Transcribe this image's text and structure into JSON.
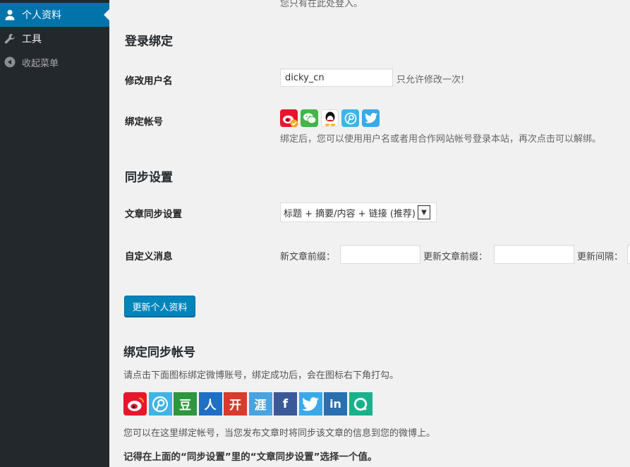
{
  "sidebar": {
    "items": [
      {
        "label": "个人资料",
        "icon": "user-icon"
      },
      {
        "label": "工具",
        "icon": "wrench-icon"
      },
      {
        "label": "收起菜单",
        "icon": "collapse-arrow-icon"
      }
    ]
  },
  "top_note": "您只有在此处登入。",
  "login_bind": {
    "heading": "登录绑定",
    "username_label": "修改用户名",
    "username_value": "dicky_cn",
    "username_hint": "只允许修改一次!",
    "account_label": "绑定帐号",
    "account_icons": [
      "weibo-icon",
      "wechat-icon",
      "qq-icon",
      "tencent-weibo-icon",
      "twitter-icon"
    ],
    "account_desc": "绑定后，您可以使用用户名或者用合作网站帐号登录本站，再次点击可以解绑。"
  },
  "sync": {
    "heading": "同步设置",
    "article_label": "文章同步设置",
    "article_selected": "标题 + 摘要/内容 + 链接 (推荐)",
    "custom_label": "自定义消息",
    "new_prefix_label": "新文章前缀：",
    "update_prefix_label": "更新文章前缀：",
    "interval_label": "更新间隔："
  },
  "update_button": "更新个人资料",
  "bind_sync": {
    "heading": "绑定同步帐号",
    "intro": "请点击下面图标绑定微博账号，绑定成功后，会在图标右下角打勾。",
    "icons": [
      {
        "name": "weibo-icon",
        "glyph": "",
        "color": "#e6162d"
      },
      {
        "name": "tencent-weibo-icon",
        "glyph": "",
        "color": "#3fb4e6"
      },
      {
        "name": "douban-icon",
        "glyph": "豆",
        "color": "#2e963d"
      },
      {
        "name": "renren-icon",
        "glyph": "人",
        "color": "#1f6fc4"
      },
      {
        "name": "kaixin-icon",
        "glyph": "开",
        "color": "#d93a2b"
      },
      {
        "name": "yaya-icon",
        "glyph": "涯",
        "color": "#4aa3df"
      },
      {
        "name": "facebook-icon",
        "glyph": "f",
        "color": "#3b5998"
      },
      {
        "name": "twitter-icon",
        "glyph": "",
        "color": "#3aa9e8"
      },
      {
        "name": "linkedin-icon",
        "glyph": "in",
        "color": "#2a6fb0"
      },
      {
        "name": "diandian-icon",
        "glyph": "",
        "color": "#17b28c"
      }
    ],
    "note": "您可以在这里绑定帐号，当您发布文章时将同步该文章的信息到您的微博上。",
    "remember": "记得在上面的“同步设置”里的“文章同步设置”选择一个值。"
  }
}
